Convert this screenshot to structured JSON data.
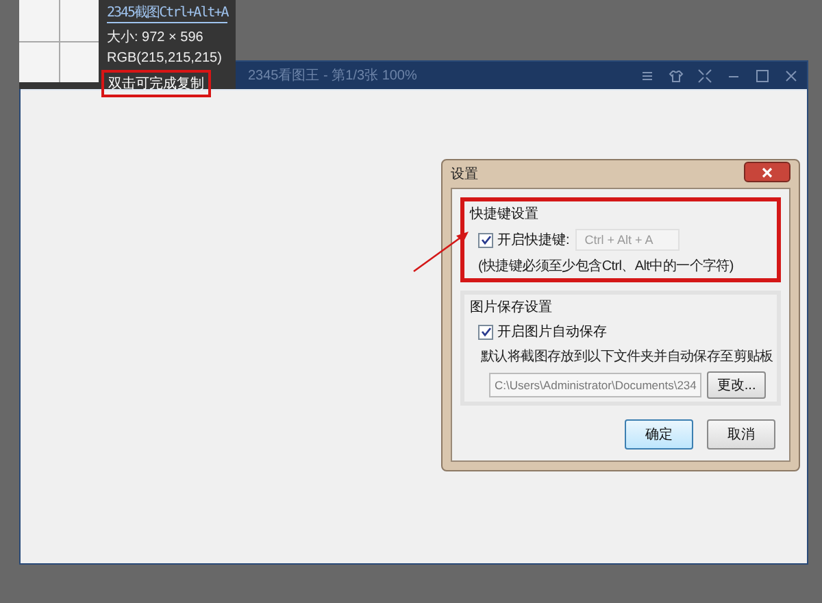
{
  "window": {
    "title": "2345看图王 - 第1/3张 100%"
  },
  "magnifier": {
    "title": "2345截图Ctrl+Alt+A",
    "size": "大小: 972 × 596",
    "rgb": "RGB(215,215,215)",
    "hint": "双击可完成复制",
    "hint_highlighted": true
  },
  "dialog": {
    "title": "设置",
    "groups": [
      {
        "kind": "hotkey",
        "title": "快捷键设置",
        "highlighted": true,
        "checkbox": {
          "label": "开启快捷键:",
          "checked": true
        },
        "value": "Ctrl + Alt + A",
        "note": "(快捷键必须至少包含Ctrl、Alt中的一个字符)"
      },
      {
        "kind": "save",
        "title": "图片保存设置",
        "highlighted": false,
        "checkbox": {
          "label": "开启图片自动保存",
          "checked": true
        },
        "description": "默认将截图存放到以下文件夹并自动保存至剪贴板",
        "path": "C:\\Users\\Administrator\\Documents\\234",
        "browse": "更改..."
      }
    ],
    "buttons": [
      {
        "label": "确定",
        "primary": true
      },
      {
        "label": "取消",
        "primary": false
      }
    ]
  }
}
